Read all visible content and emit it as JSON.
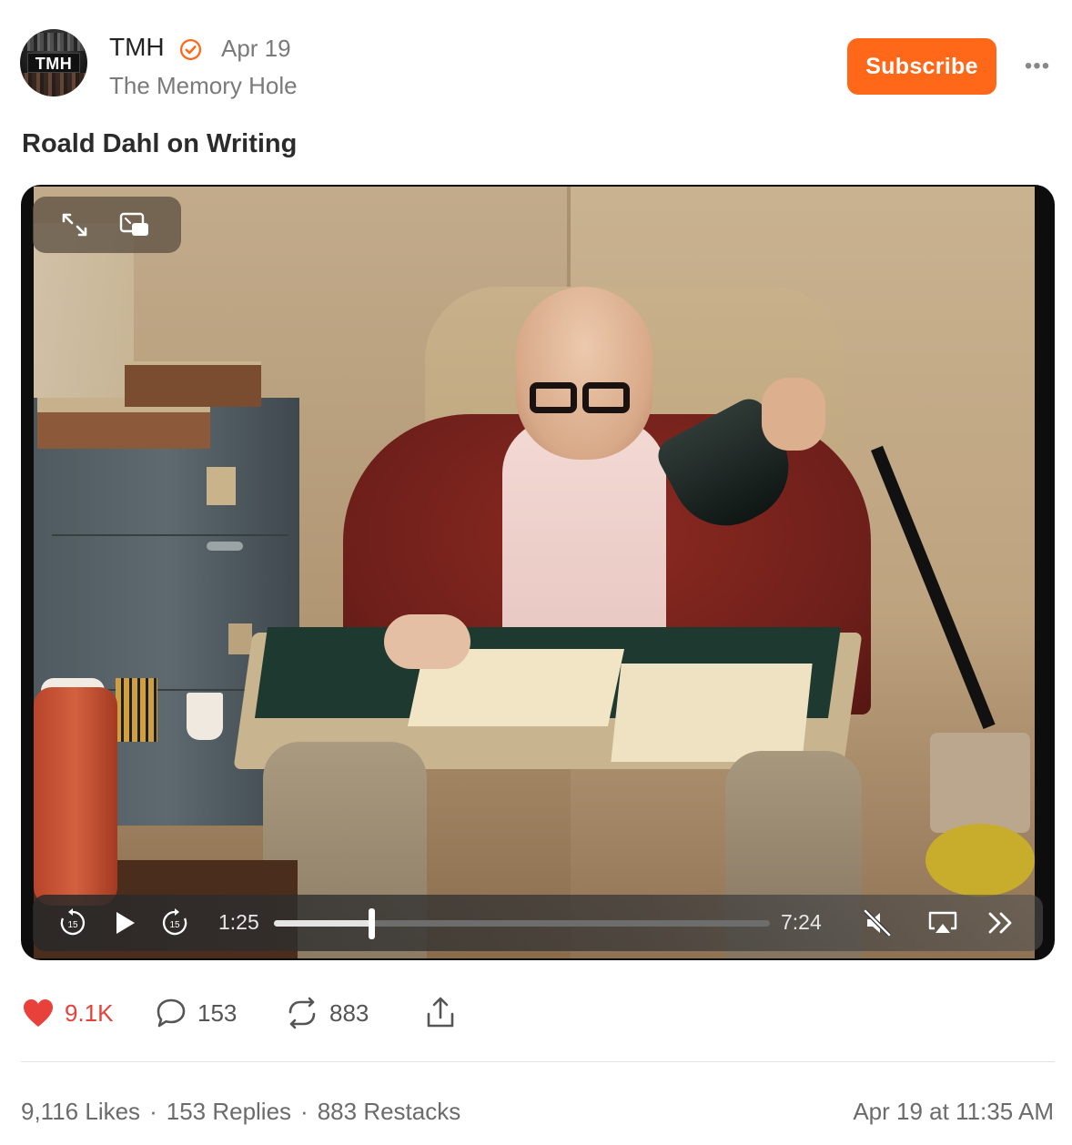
{
  "post": {
    "author": "TMH",
    "avatar_text": "TMH",
    "date": "Apr 19",
    "publication": "The Memory Hole",
    "subscribe_label": "Subscribe",
    "more_label": "•••",
    "title": "Roald Dahl on Writing"
  },
  "video": {
    "current_time": "1:25",
    "duration": "7:24",
    "progress": 0.196,
    "skip_back_label": "15",
    "skip_forward_label": "15"
  },
  "actions": {
    "likes": "9.1K",
    "comments": "153",
    "restacks": "883"
  },
  "stats": {
    "likes": "9,116 Likes",
    "replies": "153 Replies",
    "restacks": "883 Restacks",
    "separator": "·",
    "posted_at": "Apr 19 at 11:35 AM"
  },
  "colors": {
    "accent": "#ff6719",
    "like": "#e8413c",
    "muted": "#7a7a7a"
  },
  "icons": [
    "verified-badge-icon",
    "expand-icon",
    "picture-in-picture-icon",
    "skip-back-icon",
    "play-icon",
    "skip-forward-icon",
    "mute-icon",
    "airplay-icon",
    "fast-forward-icon",
    "heart-icon",
    "comment-icon",
    "restack-icon",
    "share-icon"
  ]
}
